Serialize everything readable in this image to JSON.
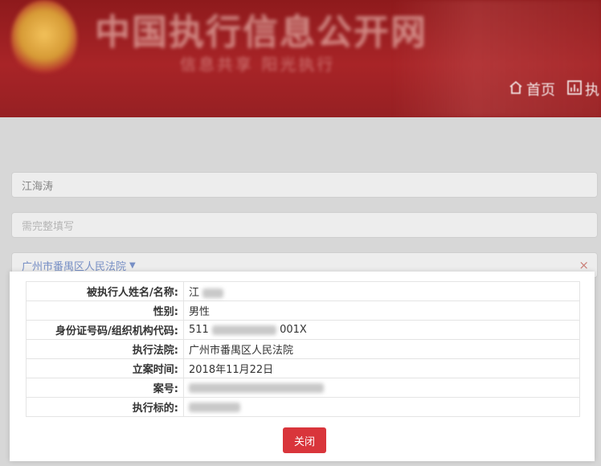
{
  "header": {
    "site_title": "中国执行信息公开网",
    "slogan": "信息共享  阳光执行",
    "nav": [
      {
        "label": "首页",
        "icon": "home-icon"
      },
      {
        "label": "执",
        "icon": "chart-icon"
      }
    ],
    "colors": {
      "banner": "#a82427",
      "nav_text": "#f3e5e5"
    }
  },
  "form": {
    "name_value": "江海涛",
    "id_placeholder": "需完整填写",
    "court_select": "广州市番禺区人民法院",
    "clear_glyph": "×"
  },
  "modal": {
    "rows": [
      {
        "label": "被执行人姓名/名称:",
        "value": "江"
      },
      {
        "label": "性别:",
        "value": "男性"
      },
      {
        "label": "身份证号码/组织机构代码:",
        "value_prefix": "511",
        "value_suffix": "001X"
      },
      {
        "label": "执行法院:",
        "value": "广州市番禺区人民法院"
      },
      {
        "label": "立案时间:",
        "value": "2018年11月22日"
      },
      {
        "label": "案号:",
        "value": ""
      },
      {
        "label": "执行标的:",
        "value": ""
      }
    ],
    "close_label": "关闭",
    "colors": {
      "close_button": "#d9353b"
    }
  }
}
